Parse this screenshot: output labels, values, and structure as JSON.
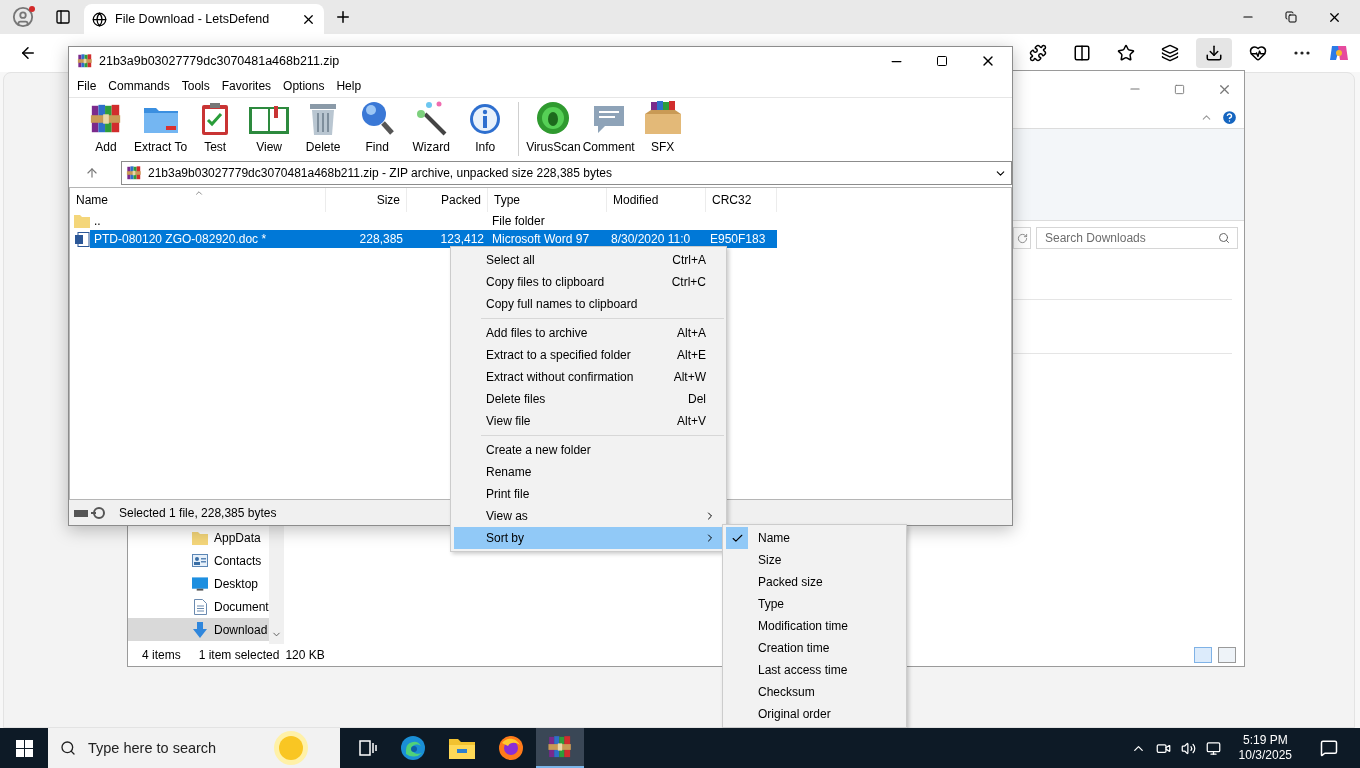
{
  "browser": {
    "tabs": [
      {
        "title": "File Download - LetsDefend",
        "selected": true
      }
    ]
  },
  "explorer": {
    "search": {
      "placeholder": "Search Downloads"
    },
    "nav": [
      {
        "label": "AppData",
        "kind": "folder",
        "selected": false
      },
      {
        "label": "Contacts",
        "kind": "contacts",
        "selected": false
      },
      {
        "label": "Desktop",
        "kind": "desktop",
        "selected": false
      },
      {
        "label": "Document",
        "kind": "document",
        "selected": false
      },
      {
        "label": "Download",
        "kind": "download",
        "selected": true
      }
    ],
    "status": [
      "4 items",
      "1 item selected",
      "120 KB"
    ]
  },
  "winrar": {
    "title": "21b3a9b03027779dc3070481a468b211.zip",
    "menu": [
      "File",
      "Commands",
      "Tools",
      "Favorites",
      "Options",
      "Help"
    ],
    "toolbar": [
      {
        "label": "Add",
        "kind": "add"
      },
      {
        "label": "Extract To",
        "kind": "extract"
      },
      {
        "label": "Test",
        "kind": "test"
      },
      {
        "label": "View",
        "kind": "view"
      },
      {
        "label": "Delete",
        "kind": "delete"
      },
      {
        "label": "Find",
        "kind": "find"
      },
      {
        "label": "Wizard",
        "kind": "wizard"
      },
      {
        "label": "Info",
        "kind": "info"
      },
      {
        "label": "VirusScan",
        "kind": "virusscan"
      },
      {
        "label": "Comment",
        "kind": "comment"
      },
      {
        "label": "SFX",
        "kind": "sfx"
      }
    ],
    "path": "21b3a9b03027779dc3070481a468b211.zip - ZIP archive, unpacked size 228,385 bytes",
    "columns": [
      "Name",
      "Size",
      "Packed",
      "Type",
      "Modified",
      "CRC32"
    ],
    "rows": [
      {
        "kind": "folder",
        "selected": false,
        "name": "..",
        "type": "File folder"
      },
      {
        "kind": "document",
        "selected": true,
        "name": "PTD-080120 ZGO-082920.doc *",
        "size": "228,385",
        "packed": "123,412",
        "type": "Microsoft Word 97",
        "modified": "8/30/2020 11:0",
        "crc": "E950F183"
      }
    ],
    "status": "Selected 1 file, 228,385 bytes"
  },
  "context_menu": {
    "groups": [
      [
        {
          "label": "Select all",
          "shortcut": "Ctrl+A",
          "kind": "command",
          "selected": false
        },
        {
          "label": "Copy files to clipboard",
          "shortcut": "Ctrl+C",
          "kind": "command",
          "selected": false
        },
        {
          "label": "Copy full names to clipboard",
          "kind": "command",
          "selected": false
        }
      ],
      [
        {
          "label": "Add files to archive",
          "shortcut": "Alt+A",
          "kind": "command",
          "selected": false
        },
        {
          "label": "Extract to a specified folder",
          "shortcut": "Alt+E",
          "kind": "command",
          "selected": false
        },
        {
          "label": "Extract without confirmation",
          "shortcut": "Alt+W",
          "kind": "command",
          "selected": false
        },
        {
          "label": "Delete files",
          "shortcut": "Del",
          "kind": "command",
          "selected": false
        },
        {
          "label": "View file",
          "shortcut": "Alt+V",
          "kind": "command",
          "selected": false
        }
      ],
      [
        {
          "label": "Create a new folder",
          "kind": "command",
          "selected": false
        },
        {
          "label": "Rename",
          "kind": "command",
          "selected": false
        },
        {
          "label": "Print file",
          "kind": "command",
          "selected": false
        },
        {
          "label": "View as",
          "kind": "submenu",
          "selected": false
        },
        {
          "label": "Sort by",
          "kind": "submenu",
          "selected": true
        }
      ]
    ]
  },
  "sort_menu": {
    "items": [
      {
        "label": "Name",
        "checked": true
      },
      {
        "label": "Size",
        "checked": false
      },
      {
        "label": "Packed size",
        "checked": false
      },
      {
        "label": "Type",
        "checked": false
      },
      {
        "label": "Modification time",
        "checked": false
      },
      {
        "label": "Creation time",
        "checked": false
      },
      {
        "label": "Last access time",
        "checked": false
      },
      {
        "label": "Checksum",
        "checked": false
      },
      {
        "label": "Original order",
        "checked": false
      }
    ]
  },
  "taskbar": {
    "search": {
      "placeholder": "Type here to search"
    },
    "apps": [
      {
        "kind": "edge",
        "selected": false
      },
      {
        "kind": "explorer",
        "selected": false
      },
      {
        "kind": "firefox",
        "selected": false
      },
      {
        "kind": "winrar",
        "selected": true
      }
    ],
    "time": "5:19 PM",
    "date": "10/3/2025"
  }
}
